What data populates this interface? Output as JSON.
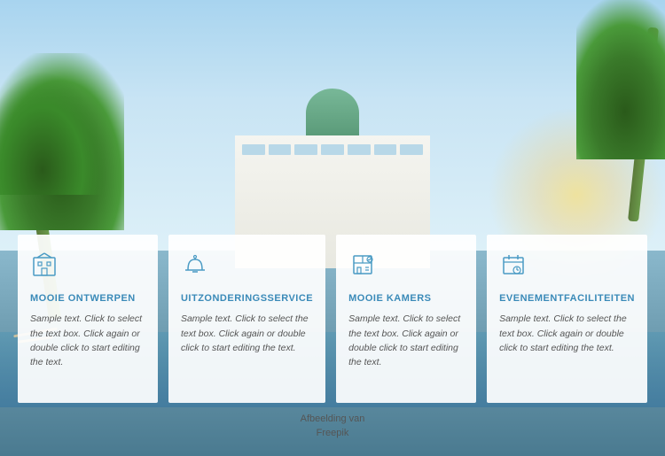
{
  "background": {
    "caption_line1": "Afbeelding van",
    "caption_line2": "Freepik"
  },
  "cards": [
    {
      "id": "card-1",
      "icon": "building-icon",
      "title": "MOOIE ONTWERPEN",
      "text": "Sample text. Click to select the text box. Click again or double click to start editing the text."
    },
    {
      "id": "card-2",
      "icon": "service-bell-icon",
      "title": "UITZONDERINGSSERVICE",
      "text": "Sample text. Click to select the text box. Click again or double click to start editing the text."
    },
    {
      "id": "card-3",
      "icon": "room-icon",
      "title": "MOOIE KAMERS",
      "text": "Sample text. Click to select the text box. Click again or double click to start editing the text."
    },
    {
      "id": "card-4",
      "icon": "event-icon",
      "title": "EVENEMENTFACILITEITEN",
      "text": "Sample text. Click to select the text box. Click again or double click to start editing the text."
    }
  ]
}
